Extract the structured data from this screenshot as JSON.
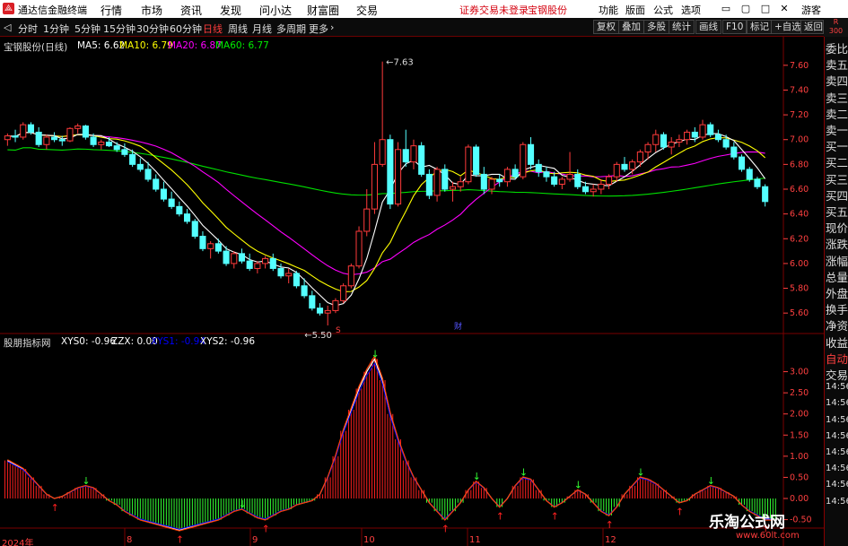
{
  "app": {
    "title": "通达信金融终端",
    "logo": "ss",
    "guest": "游客"
  },
  "menu": [
    "行情",
    "市场",
    "资讯",
    "发现",
    "问小达",
    "财富圈",
    "交易"
  ],
  "alert": {
    "text": "证券交易未登录",
    "stock": "宝钢股份"
  },
  "right_menu": [
    "功能",
    "版面",
    "公式",
    "选项"
  ],
  "toolbar": {
    "periods": [
      "分时",
      "1分钟",
      "5分钟",
      "15分钟",
      "30分钟",
      "60分钟",
      "日线",
      "周线",
      "月线",
      "多周期",
      "更多"
    ],
    "active": "日线",
    "right": [
      "复权",
      "叠加",
      "多股",
      "统计",
      "画线",
      "F10",
      "标记",
      "+自选",
      "返回"
    ]
  },
  "right_tab_header": {
    "line1": "R",
    "line2": "300"
  },
  "right_panel": [
    "委比",
    "卖五",
    "卖四",
    "卖三",
    "卖二",
    "卖一",
    "买一",
    "买二",
    "买三",
    "买四",
    "买五",
    "现价",
    "涨跌",
    "涨幅",
    "总量",
    "外盘",
    "换手",
    "净资",
    "收益",
    "自动",
    "交易",
    "14:56",
    "14:56",
    "14:56",
    "14:56",
    "14:56",
    "14:56",
    "14:56",
    "14:56"
  ],
  "main_legend": {
    "title": "宝钢股份(日线)",
    "ma5": "MA5: 6.62",
    "ma10": "MA10: 6.79",
    "ma20": "MA20: 6.87",
    "ma60": "MA60: 6.77"
  },
  "indicator_legend": {
    "title": "股朋指标网",
    "xys0": "XYS0: -0.96",
    "zzx": "ZZX: 0.00",
    "xys1": "XYS1: -0.94",
    "xys2": "XYS2: -0.96"
  },
  "colors": {
    "up": "#ff3b3b",
    "down": "#54ffff",
    "ma5": "#ffffff",
    "ma10": "#ffff00",
    "ma20": "#ff00ff",
    "ma60": "#00e000",
    "axis": "#ff4040",
    "grid": "#7a0000",
    "xys0": "#ffffff",
    "xys1": "#0000ff",
    "xys2": "#ffffff"
  },
  "price_axis": [
    "7.60",
    "7.40",
    "7.20",
    "7.00",
    "6.80",
    "6.60",
    "6.40",
    "6.20",
    "6.00",
    "5.80",
    "5.60"
  ],
  "indicator_axis": [
    "3.00",
    "2.50",
    "2.00",
    "1.50",
    "1.00",
    "0.50",
    "0.00",
    "-0.50"
  ],
  "annotations": {
    "high": "7.63",
    "low": "5.50",
    "marker_s": "S",
    "marker_cai": "财"
  },
  "dates": [
    "2024年",
    "8",
    "9",
    "10",
    "11",
    "12"
  ],
  "watermark": {
    "line1": "乐淘公式网",
    "line2": "www.60lt.com"
  },
  "chart_data": {
    "type": "candlestick",
    "title": "宝钢股份(日线)",
    "ohlc": [
      [
        7.0,
        7.05,
        6.95,
        7.03
      ],
      [
        7.03,
        7.08,
        6.98,
        7.02
      ],
      [
        7.02,
        7.14,
        7.0,
        7.12
      ],
      [
        7.12,
        7.14,
        7.04,
        7.06
      ],
      [
        7.06,
        7.1,
        6.94,
        6.96
      ],
      [
        6.96,
        7.04,
        6.92,
        7.02
      ],
      [
        7.02,
        7.06,
        6.98,
        7.0
      ],
      [
        7.0,
        7.03,
        6.95,
        6.99
      ],
      [
        6.99,
        7.1,
        6.98,
        7.09
      ],
      [
        7.09,
        7.13,
        7.05,
        7.11
      ],
      [
        7.11,
        7.12,
        7.0,
        7.02
      ],
      [
        7.02,
        7.05,
        6.94,
        6.96
      ],
      [
        6.96,
        7.0,
        6.92,
        6.98
      ],
      [
        6.98,
        7.02,
        6.94,
        6.95
      ],
      [
        6.95,
        6.98,
        6.9,
        6.92
      ],
      [
        6.92,
        6.97,
        6.86,
        6.88
      ],
      [
        6.88,
        6.92,
        6.78,
        6.8
      ],
      [
        6.8,
        6.85,
        6.74,
        6.76
      ],
      [
        6.76,
        6.82,
        6.66,
        6.68
      ],
      [
        6.68,
        6.72,
        6.58,
        6.6
      ],
      [
        6.6,
        6.66,
        6.5,
        6.52
      ],
      [
        6.52,
        6.58,
        6.44,
        6.46
      ],
      [
        6.46,
        6.5,
        6.38,
        6.4
      ],
      [
        6.4,
        6.44,
        6.32,
        6.34
      ],
      [
        6.34,
        6.36,
        6.2,
        6.22
      ],
      [
        6.22,
        6.26,
        6.1,
        6.12
      ],
      [
        6.12,
        6.18,
        6.04,
        6.16
      ],
      [
        6.16,
        6.2,
        6.08,
        6.1
      ],
      [
        6.1,
        6.14,
        5.98,
        6.0
      ],
      [
        6.0,
        6.1,
        5.96,
        6.08
      ],
      [
        6.08,
        6.12,
        6.0,
        6.02
      ],
      [
        6.02,
        6.08,
        5.94,
        5.96
      ],
      [
        5.96,
        6.02,
        5.92,
        6.0
      ],
      [
        6.0,
        6.06,
        5.96,
        6.04
      ],
      [
        6.04,
        6.08,
        5.94,
        5.96
      ],
      [
        5.96,
        6.0,
        5.88,
        5.9
      ],
      [
        5.9,
        5.96,
        5.84,
        5.92
      ],
      [
        5.92,
        5.94,
        5.8,
        5.82
      ],
      [
        5.82,
        5.88,
        5.72,
        5.74
      ],
      [
        5.74,
        5.78,
        5.62,
        5.64
      ],
      [
        5.64,
        5.68,
        5.58,
        5.6
      ],
      [
        5.6,
        5.66,
        5.5,
        5.62
      ],
      [
        5.62,
        5.72,
        5.6,
        5.7
      ],
      [
        5.7,
        5.84,
        5.68,
        5.82
      ],
      [
        5.82,
        6.0,
        5.8,
        5.98
      ],
      [
        5.98,
        6.3,
        5.96,
        6.26
      ],
      [
        6.26,
        6.6,
        6.22,
        6.44
      ],
      [
        6.44,
        6.98,
        6.4,
        6.8
      ],
      [
        6.8,
        7.63,
        6.78,
        7.0
      ],
      [
        7.0,
        7.04,
        6.44,
        6.48
      ],
      [
        6.48,
        6.98,
        6.46,
        6.92
      ],
      [
        6.92,
        7.08,
        6.78,
        6.82
      ],
      [
        6.82,
        7.0,
        6.76,
        6.95
      ],
      [
        6.95,
        6.98,
        6.7,
        6.72
      ],
      [
        6.72,
        6.76,
        6.52,
        6.55
      ],
      [
        6.55,
        6.78,
        6.5,
        6.76
      ],
      [
        6.76,
        6.8,
        6.58,
        6.6
      ],
      [
        6.6,
        6.66,
        6.5,
        6.62
      ],
      [
        6.62,
        6.7,
        6.58,
        6.66
      ],
      [
        6.66,
        6.96,
        6.64,
        6.94
      ],
      [
        6.94,
        6.96,
        6.7,
        6.72
      ],
      [
        6.72,
        6.78,
        6.56,
        6.6
      ],
      [
        6.6,
        6.7,
        6.56,
        6.68
      ],
      [
        6.68,
        6.72,
        6.62,
        6.66
      ],
      [
        6.66,
        6.78,
        6.62,
        6.76
      ],
      [
        6.76,
        6.8,
        6.68,
        6.7
      ],
      [
        6.7,
        6.98,
        6.68,
        6.96
      ],
      [
        6.96,
        7.02,
        6.76,
        6.8
      ],
      [
        6.8,
        6.84,
        6.7,
        6.74
      ],
      [
        6.74,
        6.78,
        6.66,
        6.7
      ],
      [
        6.7,
        6.74,
        6.62,
        6.64
      ],
      [
        6.64,
        6.7,
        6.6,
        6.68
      ],
      [
        6.68,
        6.9,
        6.66,
        6.72
      ],
      [
        6.72,
        6.76,
        6.6,
        6.62
      ],
      [
        6.62,
        6.66,
        6.56,
        6.58
      ],
      [
        6.58,
        6.64,
        6.54,
        6.6
      ],
      [
        6.6,
        6.68,
        6.56,
        6.64
      ],
      [
        6.64,
        6.72,
        6.6,
        6.7
      ],
      [
        6.7,
        6.82,
        6.66,
        6.8
      ],
      [
        6.8,
        6.86,
        6.74,
        6.76
      ],
      [
        6.76,
        6.84,
        6.72,
        6.82
      ],
      [
        6.82,
        6.92,
        6.78,
        6.9
      ],
      [
        6.9,
        6.98,
        6.84,
        6.96
      ],
      [
        6.96,
        7.08,
        6.9,
        7.04
      ],
      [
        7.04,
        7.06,
        6.92,
        6.94
      ],
      [
        6.94,
        7.02,
        6.88,
        6.98
      ],
      [
        6.98,
        7.04,
        6.94,
        7.0
      ],
      [
        7.0,
        7.08,
        6.96,
        7.06
      ],
      [
        7.06,
        7.1,
        6.98,
        7.02
      ],
      [
        7.02,
        7.16,
        7.0,
        7.12
      ],
      [
        7.12,
        7.14,
        7.02,
        7.04
      ],
      [
        7.04,
        7.08,
        6.98,
        7.0
      ],
      [
        7.0,
        7.04,
        6.92,
        6.94
      ],
      [
        6.94,
        6.98,
        6.84,
        6.86
      ],
      [
        6.86,
        6.88,
        6.74,
        6.76
      ],
      [
        6.76,
        6.78,
        6.66,
        6.68
      ],
      [
        6.68,
        6.7,
        6.6,
        6.62
      ],
      [
        6.62,
        6.64,
        6.46,
        6.5
      ]
    ],
    "indicator": [
      0.9,
      0.8,
      0.7,
      0.5,
      0.3,
      0.1,
      0.0,
      0.05,
      0.15,
      0.25,
      0.3,
      0.25,
      0.1,
      -0.05,
      -0.15,
      -0.3,
      -0.4,
      -0.5,
      -0.55,
      -0.6,
      -0.65,
      -0.7,
      -0.75,
      -0.7,
      -0.65,
      -0.6,
      -0.55,
      -0.5,
      -0.4,
      -0.3,
      -0.25,
      -0.35,
      -0.45,
      -0.5,
      -0.4,
      -0.3,
      -0.25,
      -0.15,
      -0.1,
      -0.05,
      0.1,
      0.5,
      1.0,
      1.6,
      2.1,
      2.6,
      3.0,
      3.3,
      2.8,
      2.0,
      1.4,
      0.9,
      0.5,
      0.2,
      -0.1,
      -0.3,
      -0.5,
      -0.3,
      -0.1,
      0.2,
      0.4,
      0.25,
      0.0,
      -0.2,
      0.0,
      0.3,
      0.5,
      0.45,
      0.2,
      -0.05,
      -0.2,
      -0.1,
      0.05,
      0.2,
      0.1,
      -0.1,
      -0.3,
      -0.4,
      -0.2,
      0.1,
      0.3,
      0.5,
      0.45,
      0.35,
      0.2,
      0.05,
      -0.1,
      -0.05,
      0.1,
      0.2,
      0.3,
      0.25,
      0.15,
      0.05,
      -0.15,
      -0.3,
      -0.4,
      -0.5,
      -0.5
    ],
    "ylim": [
      5.5,
      7.7
    ],
    "indicator_ylim": [
      -0.7,
      3.5
    ]
  }
}
